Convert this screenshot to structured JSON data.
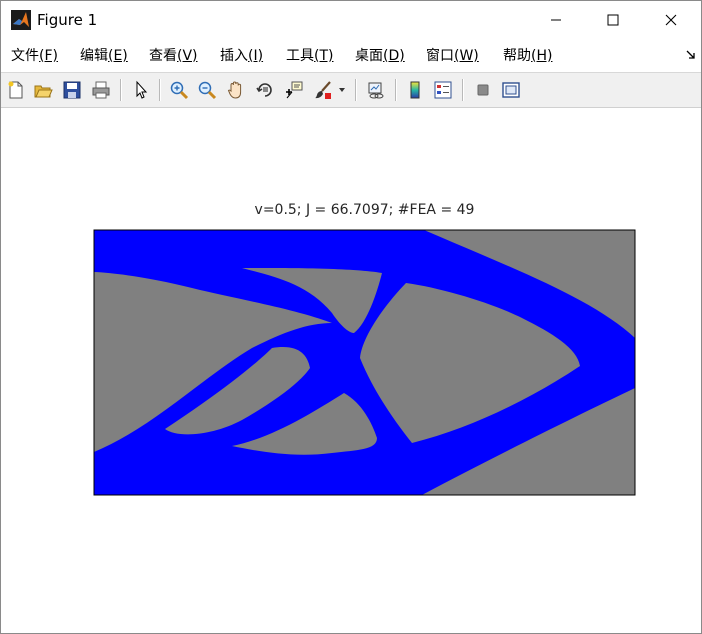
{
  "window": {
    "title": "Figure 1",
    "icons": {
      "app": "matlab-logo-icon",
      "minimize": "minimize-icon",
      "maximize": "maximize-icon",
      "close": "close-icon"
    }
  },
  "menu": {
    "items": [
      {
        "label": "文件",
        "key": "(F)"
      },
      {
        "label": "编辑",
        "key": "(E)"
      },
      {
        "label": "查看",
        "key": "(V)"
      },
      {
        "label": "插入",
        "key": "(I)"
      },
      {
        "label": "工具",
        "key": "(T)"
      },
      {
        "label": "桌面",
        "key": "(D)"
      },
      {
        "label": "窗口",
        "key": "(W)"
      },
      {
        "label": "帮助",
        "key": "(H)"
      }
    ],
    "overflow_icon": "dock-arrow-icon"
  },
  "toolbar": {
    "buttons": [
      "new-figure-icon",
      "open-file-icon",
      "save-icon",
      "print-icon",
      "edit-plot-arrow-icon",
      "zoom-in-icon",
      "zoom-out-icon",
      "pan-hand-icon",
      "rotate-3d-icon",
      "data-cursor-icon",
      "brush-icon",
      "brush-dropdown-icon",
      "link-plot-icon",
      "insert-colorbar-icon",
      "insert-legend-icon",
      "hide-plot-tools-icon",
      "show-plot-tools-icon"
    ]
  },
  "plot": {
    "title": "v=0.5; J = 66.7097; #FEA = 49",
    "colors": {
      "background": "#808080",
      "material": "#0000ff",
      "frame": "#000000"
    }
  }
}
